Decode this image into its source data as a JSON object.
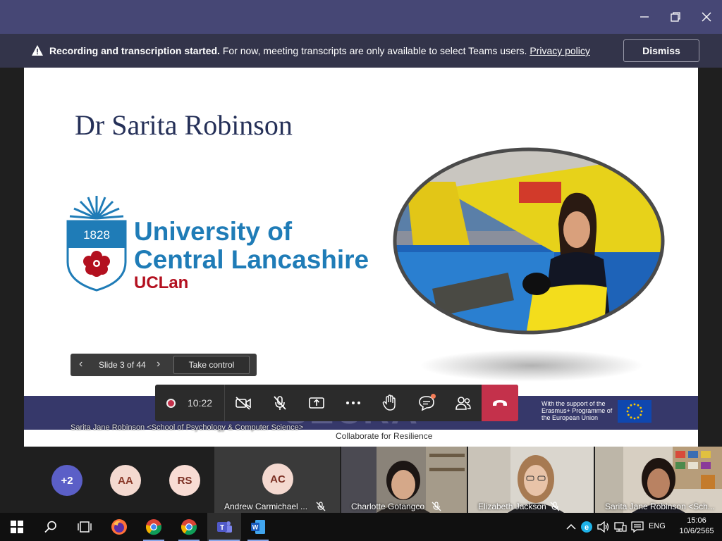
{
  "window": {
    "minimize": "—",
    "restore": "❐",
    "close": "✕"
  },
  "banner": {
    "bold_text": "Recording and transcription started.",
    "text": " For now, meeting transcripts are only available to select Teams users. ",
    "link": "Privacy policy",
    "dismiss_label": "Dismiss"
  },
  "slide": {
    "title": "Dr Sarita Robinson",
    "logo_year": "1828",
    "university_line1": "University of",
    "university_line2": "Central Lancashire",
    "university_short": "UCLan",
    "footer_brand": "SECRA",
    "footer_tagline": "Collaborate for Resilience",
    "erasmus_text": "With the support of the Erasmus+ Programme of the European Union",
    "presenter_caption": "Sarita Jane Robinson <School of Psychology & Computer Science>"
  },
  "slide_nav": {
    "prev": "‹",
    "counter": "Slide 3 of 44",
    "next": "›",
    "take_control": "Take control"
  },
  "controls": {
    "timer": "10:22"
  },
  "participants": {
    "overflow": "+2",
    "avatars": [
      {
        "initials": "AA",
        "bg": "#f4d9d0",
        "fg": "#8b3a2a"
      },
      {
        "initials": "RS",
        "bg": "#f8dcd4",
        "fg": "#7a2e22"
      }
    ],
    "andrew": {
      "initials": "AC",
      "name": "Andrew Carmichael ..."
    },
    "tiles": [
      {
        "name": "Charlotte Gotangco"
      },
      {
        "name": "Elizabeth Jackson"
      },
      {
        "name": "Sarita Jane Robinson <Sch..."
      }
    ]
  },
  "taskbar": {
    "language": "ENG",
    "time": "15:06",
    "date": "10/6/2565"
  },
  "colors": {
    "teams_purple": "#464775",
    "banner_bg": "#33344a",
    "hangup_red": "#c4314b",
    "uclan_blue": "#1f7cb7",
    "uclan_red": "#b3101f",
    "title_navy": "#253058"
  }
}
